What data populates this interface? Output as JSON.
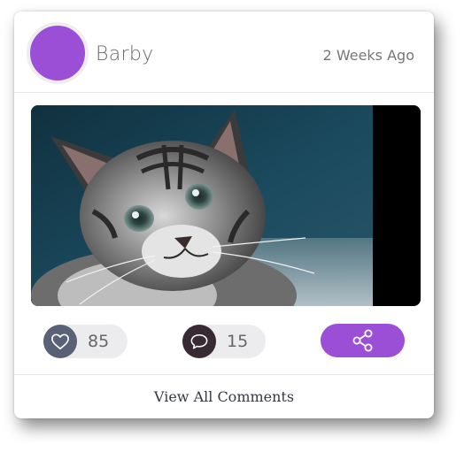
{
  "post": {
    "author": "Barby",
    "timestamp": "2 Weeks Ago",
    "image_icon": "kitten-photo",
    "likes": "85",
    "comments": "15",
    "view_all_label": "View All Comments"
  },
  "colors": {
    "accent": "#9b4fd6",
    "like_icon_bg": "#596176",
    "comment_icon_bg": "#382a32",
    "pill_bg": "#ececef"
  },
  "icons": {
    "like": "heart-icon",
    "comment": "speech-bubble-icon",
    "share": "share-icon"
  }
}
